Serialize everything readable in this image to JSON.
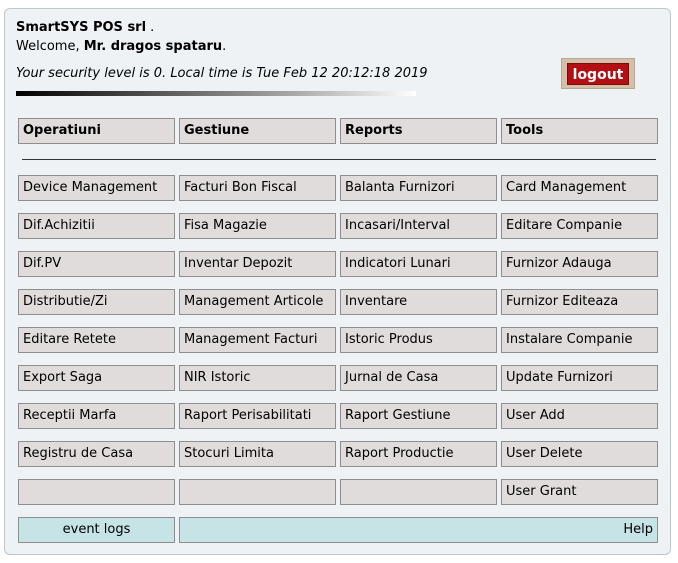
{
  "header": {
    "company": "SmartSYS POS srl",
    "company_suffix": " .",
    "welcome_prefix": "Welcome, ",
    "user_name": "Mr. dragos spataru",
    "welcome_suffix": ".",
    "security_line": "Your security level is 0. Local time is Tue Feb 12 20:12:18 2019"
  },
  "logout_label": "logout",
  "columns": [
    "Operatiuni",
    "Gestiune",
    "Reports",
    "Tools"
  ],
  "menu": {
    "operatiuni": [
      "Device Management",
      "Dif.Achizitii",
      "Dif.PV",
      "Distributie/Zi",
      "Editare Retete",
      "Export Saga",
      "Receptii Marfa",
      "Registru de Casa",
      ""
    ],
    "gestiune": [
      "Facturi Bon Fiscal",
      "Fisa Magazie",
      "Inventar Depozit",
      "Management Articole",
      "Management Facturi",
      "NIR Istoric",
      "Raport Perisabilitati",
      "Stocuri Limita",
      ""
    ],
    "reports": [
      "Balanta Furnizori",
      "Incasari/Interval",
      "Indicatori Lunari",
      "Inventare",
      "Istoric Produs",
      "Jurnal de Casa",
      "Raport Gestiune",
      "Raport Productie",
      ""
    ],
    "tools": [
      "Card Management",
      "Editare Companie",
      "Furnizor Adauga",
      "Furnizor Editeaza",
      "Instalare Companie",
      "Update Furnizori",
      "User Add",
      "User Delete",
      "User Grant"
    ]
  },
  "footer": {
    "event_logs": "event logs",
    "help": "Help"
  },
  "colors": {
    "logout_bg": "#b41014",
    "cell_bg": "#e0dcdb",
    "footer_bg": "#c6e3e6"
  }
}
